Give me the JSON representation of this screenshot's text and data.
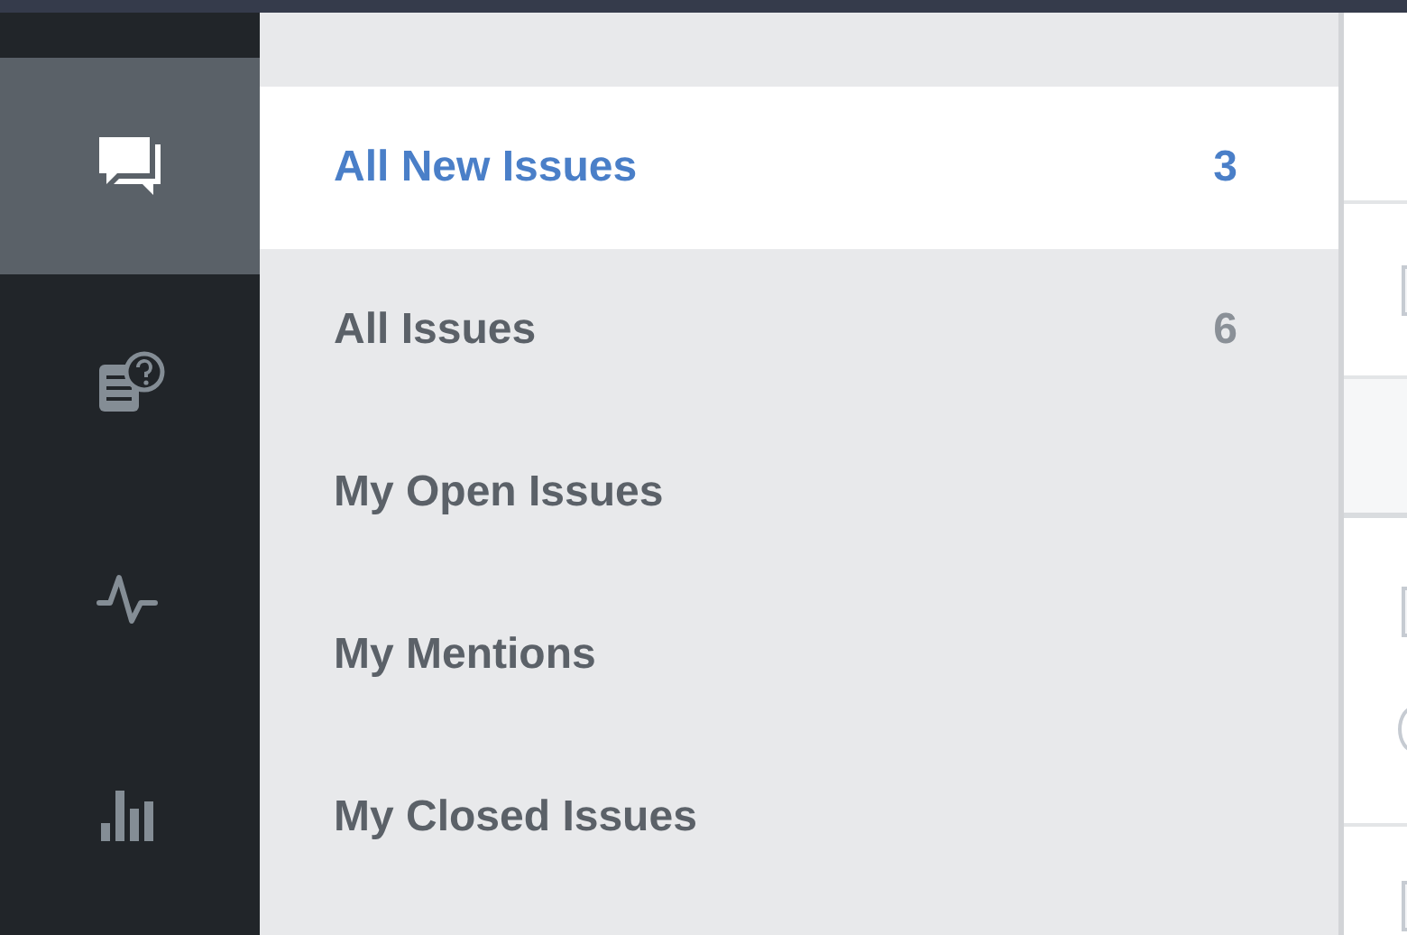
{
  "rail": [
    {
      "kind": "chat",
      "selected": true
    },
    {
      "kind": "faq",
      "selected": false
    },
    {
      "kind": "pulse",
      "selected": false
    },
    {
      "kind": "bars",
      "selected": false
    }
  ],
  "filters": [
    {
      "label": "All New Issues",
      "count": "3",
      "selected": true
    },
    {
      "label": "All Issues",
      "count": "6",
      "selected": false
    },
    {
      "label": "My Open Issues",
      "selected": false
    },
    {
      "label": "My Mentions",
      "selected": false
    },
    {
      "label": "My Closed Issues",
      "selected": false
    }
  ]
}
